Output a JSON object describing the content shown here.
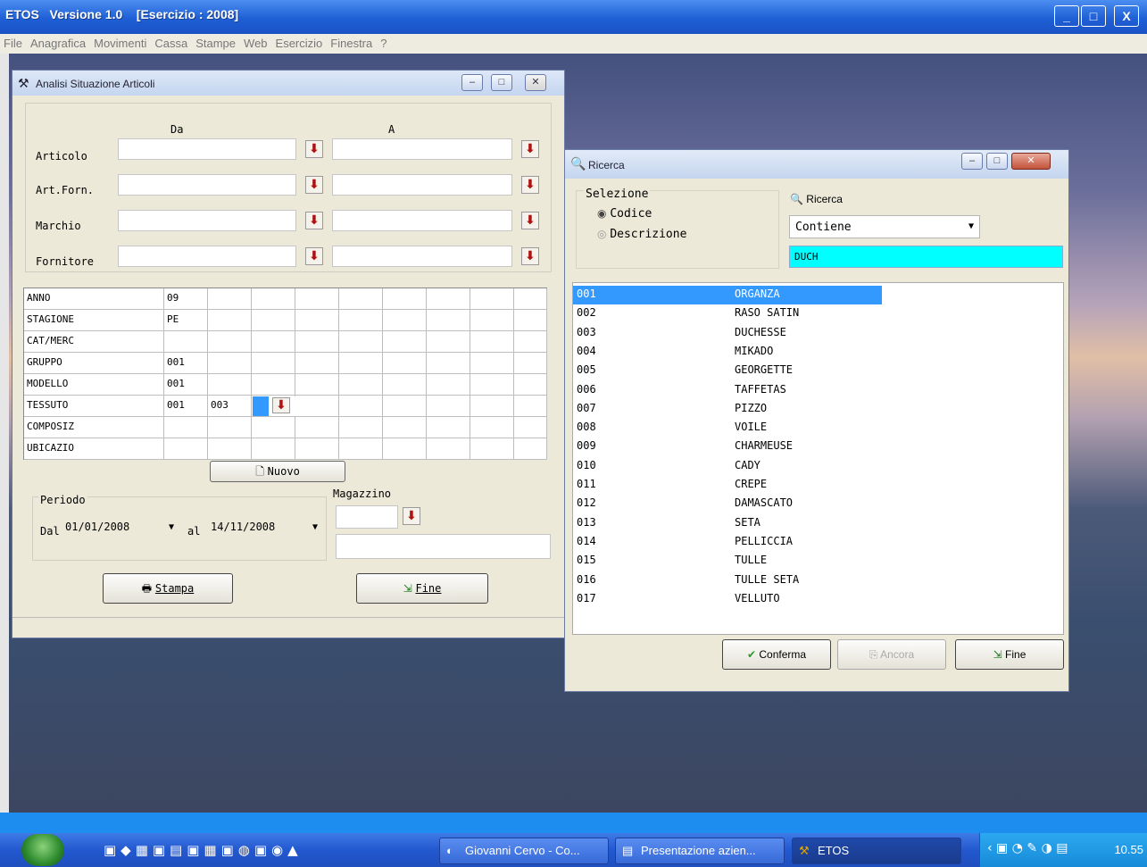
{
  "app": {
    "title": "ETOS   Versione 1.0    [Esercizio : 2008]",
    "win_buttons": [
      "_",
      "□",
      "X"
    ]
  },
  "menubar": [
    "File",
    "Anagrafica",
    "Movimenti",
    "Cassa",
    "Stampe",
    "Web",
    "Esercizio",
    "Finestra",
    "?"
  ],
  "analisi": {
    "title": "Analisi Situazione Articoli",
    "col_da": "Da",
    "col_a": "A",
    "rows": [
      "Articolo",
      "Art.Forn.",
      "Marchio",
      "Fornitore"
    ],
    "grid": [
      {
        "label": "ANNO",
        "vals": [
          "09",
          "",
          ""
        ]
      },
      {
        "label": "STAGIONE",
        "vals": [
          "PE",
          "",
          ""
        ]
      },
      {
        "label": "CAT/MERC",
        "vals": [
          "",
          "",
          ""
        ]
      },
      {
        "label": "GRUPPO",
        "vals": [
          "001",
          "",
          ""
        ]
      },
      {
        "label": "MODELLO",
        "vals": [
          "001",
          "",
          ""
        ]
      },
      {
        "label": "TESSUTO",
        "vals": [
          "001",
          "003",
          ""
        ]
      },
      {
        "label": "COMPOSIZ",
        "vals": [
          "",
          "",
          ""
        ]
      },
      {
        "label": "UBICAZIO",
        "vals": [
          "",
          "",
          ""
        ]
      }
    ],
    "nuovo_label": "Nuovo",
    "periodo_label": "Periodo",
    "dal_label": "Dal",
    "dal_value": "01/01/2008",
    "al_label": "al",
    "al_value": "14/11/2008",
    "magazzino_label": "Magazzino",
    "stampa_label": "Stampa",
    "fine_label": "Fine"
  },
  "ricerca": {
    "title": "Ricerca",
    "selezione_label": "Selezione",
    "opt_codice": "Codice",
    "opt_descrizione": "Descrizione",
    "ricerca_label": "Ricerca",
    "mode_value": "Contiene",
    "search_value": "DUCH",
    "items": [
      {
        "code": "001",
        "name": "ORGANZA"
      },
      {
        "code": "002",
        "name": "RASO SATIN"
      },
      {
        "code": "003",
        "name": "DUCHESSE"
      },
      {
        "code": "004",
        "name": "MIKADO"
      },
      {
        "code": "005",
        "name": "GEORGETTE"
      },
      {
        "code": "006",
        "name": "TAFFETAS"
      },
      {
        "code": "007",
        "name": "PIZZO"
      },
      {
        "code": "008",
        "name": "VOILE"
      },
      {
        "code": "009",
        "name": "CHARMEUSE"
      },
      {
        "code": "010",
        "name": "CADY"
      },
      {
        "code": "011",
        "name": "CREPE"
      },
      {
        "code": "012",
        "name": "DAMASCATO"
      },
      {
        "code": "013",
        "name": "SETA"
      },
      {
        "code": "014",
        "name": "PELLICCIA"
      },
      {
        "code": "015",
        "name": "TULLE"
      },
      {
        "code": "016",
        "name": "TULLE SETA"
      },
      {
        "code": "017",
        "name": "VELLUTO"
      }
    ],
    "conferma_label": "Conferma",
    "ancora_label": "Ancora",
    "fine_label": "Fine"
  },
  "taskbar": {
    "tasks": [
      "Giovanni Cervo - Co...",
      "Presentazione azien...",
      "ETOS"
    ],
    "clock": "10.55"
  },
  "colors": {
    "selection": "#3399ff",
    "search_bg": "#00ffff",
    "picker_arrow": "#b01010"
  }
}
